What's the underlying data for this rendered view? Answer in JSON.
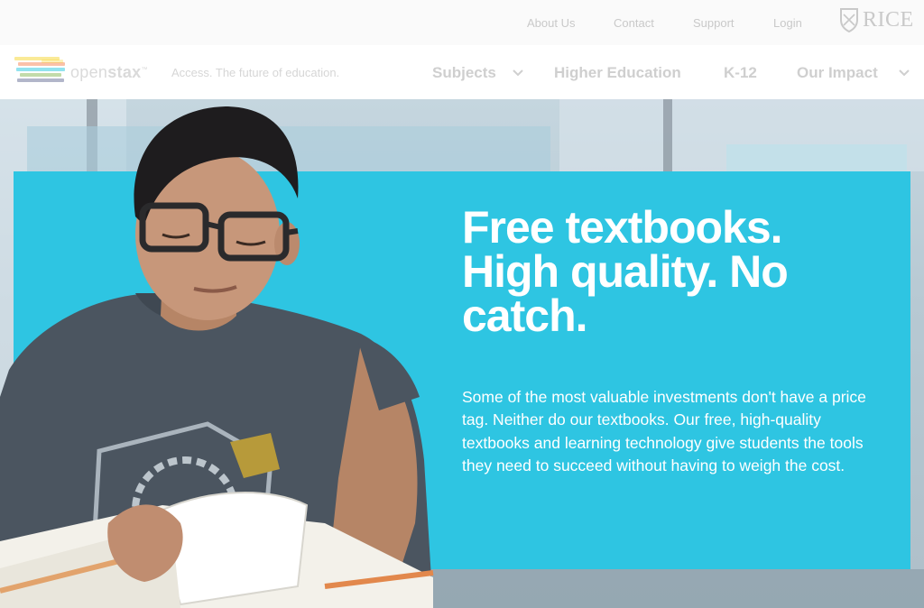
{
  "utility": {
    "links": [
      "About Us",
      "Contact",
      "Support",
      "Login"
    ],
    "rice_label": "RICE"
  },
  "nav": {
    "logo_open": "open",
    "logo_stax": "stax",
    "logo_tm": "™",
    "tagline": "Access. The future of education.",
    "items": [
      "Subjects",
      "Higher Education",
      "K-12",
      "Our Impact"
    ]
  },
  "hero": {
    "headline": "Free textbooks. High quality. No catch.",
    "body": "Some of the most valuable investments don't have a price tag. Neither do our textbooks. Our free, high-quality textbooks and learning technology give students the tools they need to succeed without having to weigh the cost."
  },
  "colors": {
    "accent_cyan": "#2ec5e2",
    "logo_stripes": [
      "#f4d019",
      "#f47641",
      "#0dc0dc",
      "#77af42",
      "#232e66"
    ]
  },
  "icons": [
    "rice-shield-icon",
    "openstax-logo-icon",
    "chevron-down-icon"
  ]
}
